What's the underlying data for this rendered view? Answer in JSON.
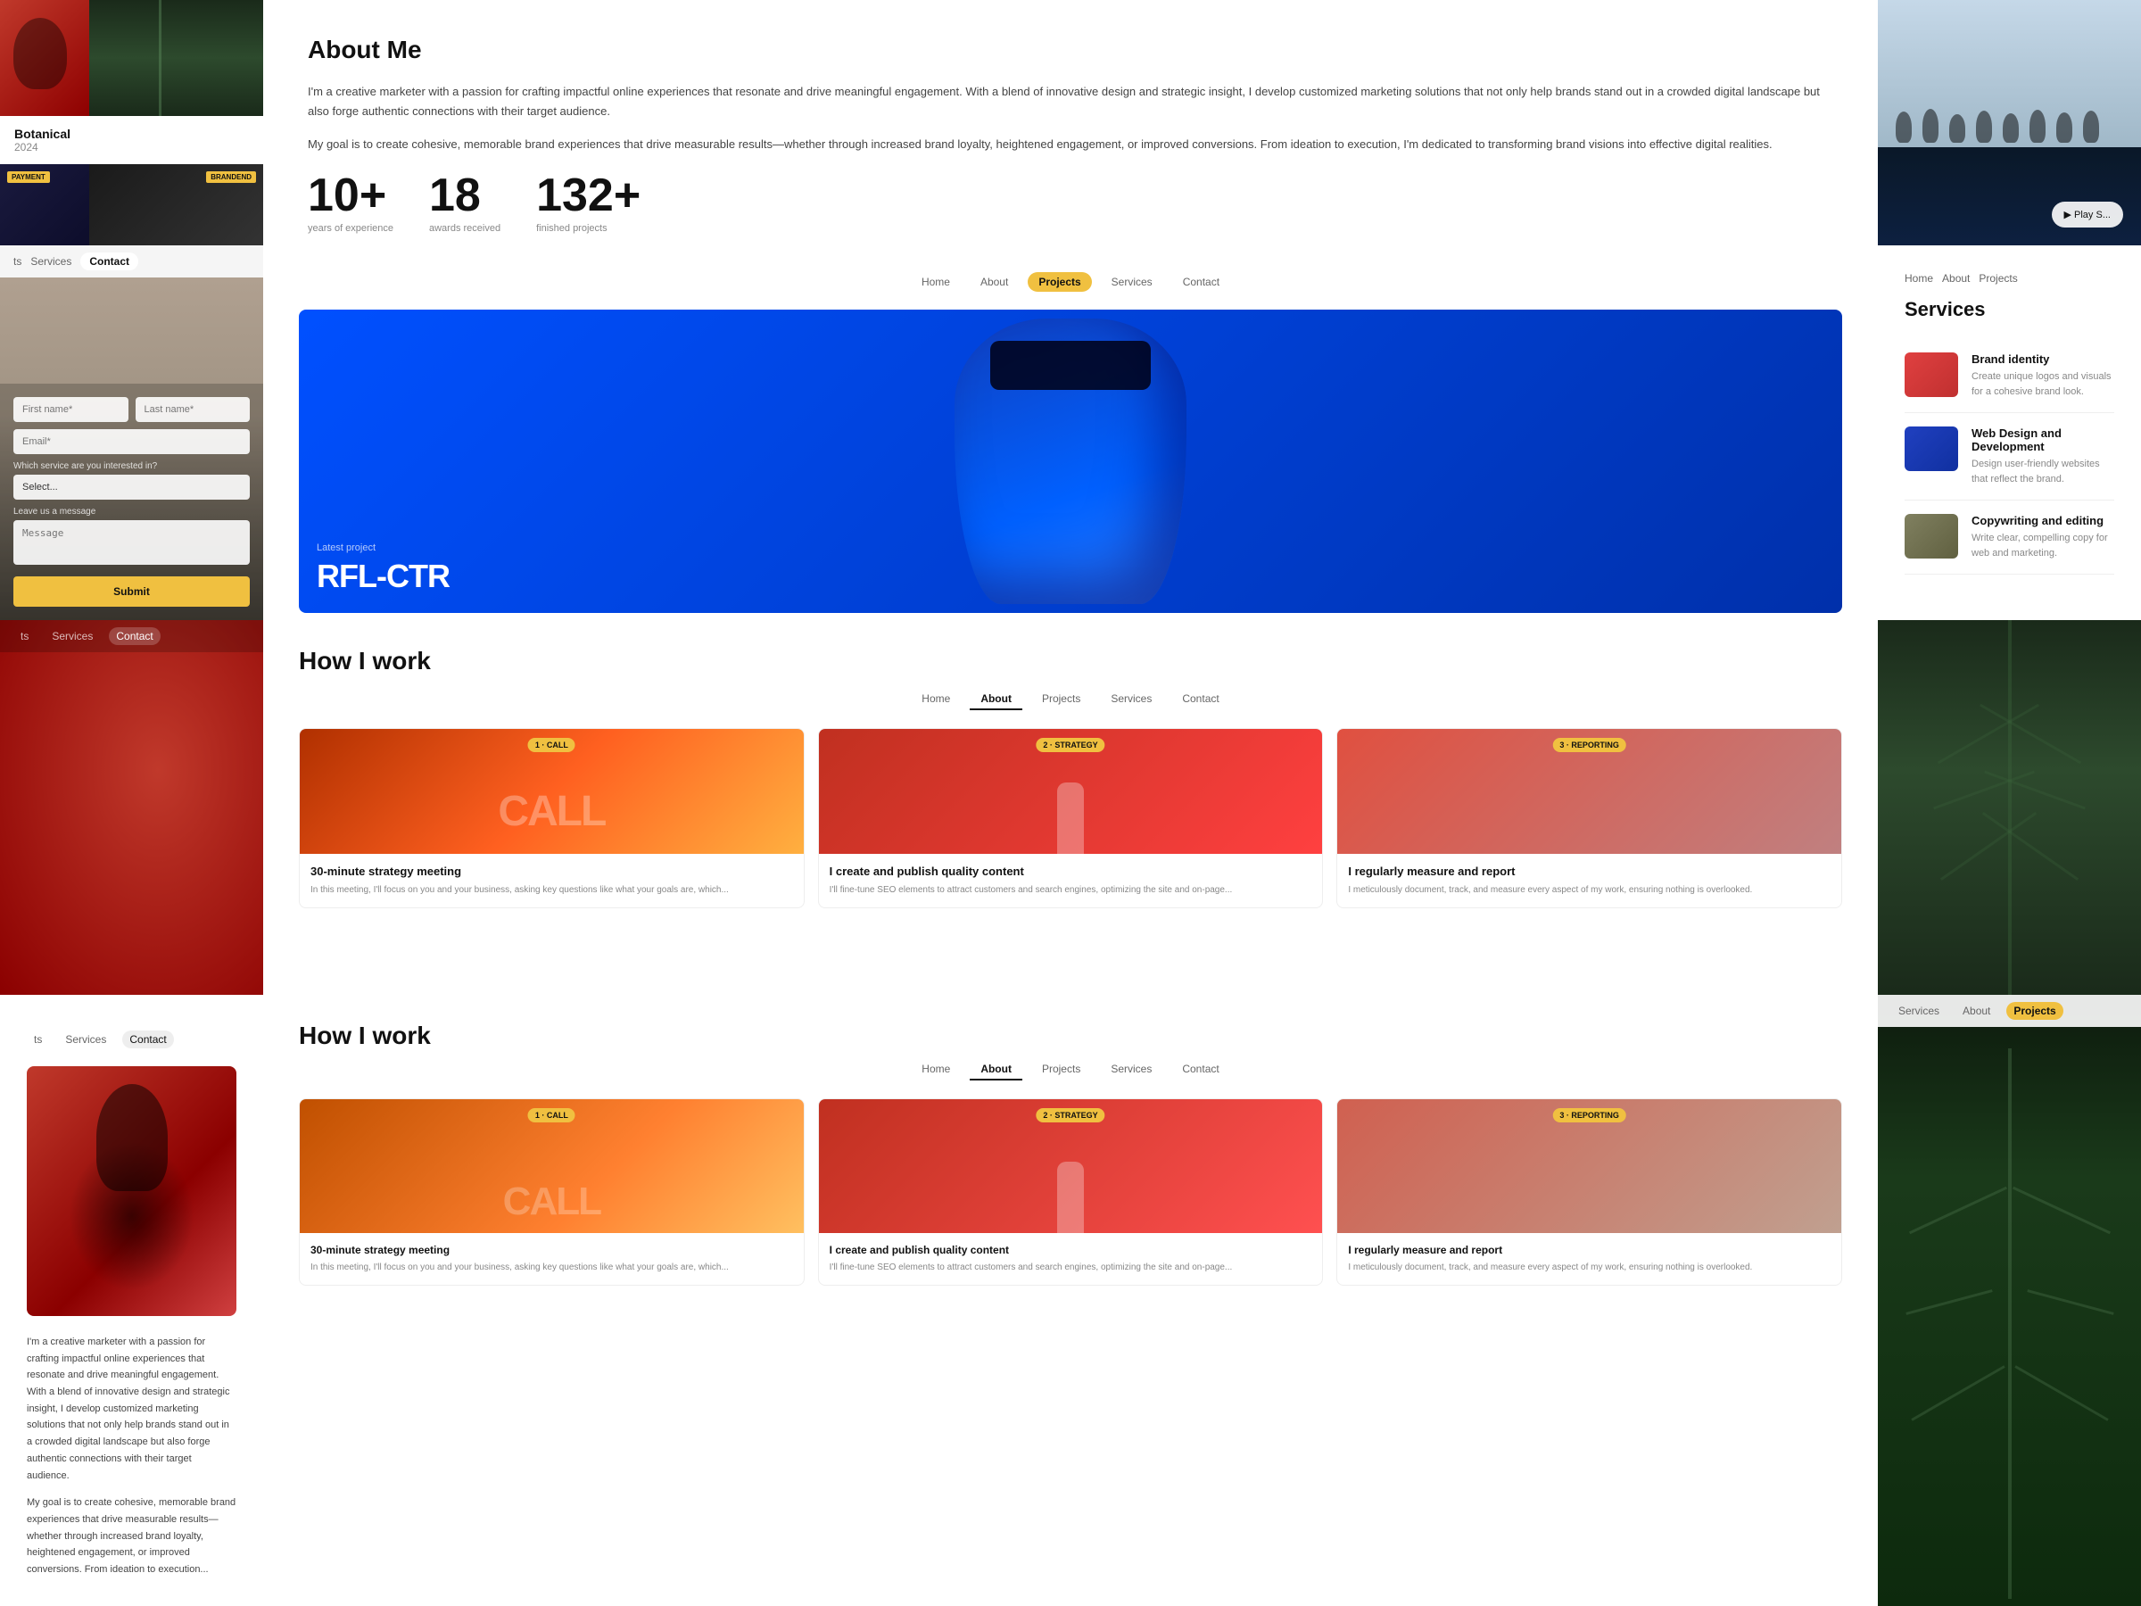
{
  "topLeft": {
    "botanical": {
      "title": "Botanical",
      "year": "2024"
    },
    "paymentBadge": "PAYMENT",
    "brandBadge": "BRANDEND"
  },
  "aboutMe": {
    "title": "About Me",
    "para1": "I'm a creative marketer with a passion for crafting impactful online experiences that resonate and drive meaningful engagement. With a blend of innovative design and strategic insight, I develop customized marketing solutions that not only help brands stand out in a crowded digital landscape but also forge authentic connections with their target audience.",
    "para2": "My goal is to create cohesive, memorable brand experiences that drive measurable results—whether through increased brand loyalty, heightened engagement, or improved conversions. From ideation to execution, I'm dedicated to transforming brand visions into effective digital realities.",
    "stats": [
      {
        "number": "10+",
        "label": "years of experience"
      },
      {
        "number": "18",
        "label": "awards received"
      },
      {
        "number": "132+",
        "label": "finished projects"
      }
    ]
  },
  "topRight": {
    "playLabel": "▶ Play S..."
  },
  "contactNav": {
    "items": [
      "ts",
      "Services",
      "Contact"
    ],
    "active": "Contact"
  },
  "form": {
    "firstName": "First name*",
    "lastName": "Last name*",
    "email": "Email*",
    "serviceLabel": "Which service are you interested in?",
    "selectPlaceholder": "Select...",
    "messageLabel": "Leave us a message",
    "messagePlaceholder": "Message",
    "submitLabel": "Submit"
  },
  "projectsNav": {
    "items": [
      "Home",
      "About",
      "Projects",
      "Services",
      "Contact"
    ],
    "active": "Projects"
  },
  "project": {
    "latestLabel": "Latest project",
    "name": "RFL-CTR"
  },
  "services": {
    "title": "Services",
    "nav": {
      "items": [
        "Home",
        "About",
        "Projects"
      ],
      "active": null
    },
    "items": [
      {
        "name": "Brand identity",
        "desc": "Create unique logos and visuals for a cohesive brand look."
      },
      {
        "name": "Web Design and Development",
        "desc": "Design user-friendly websites that reflect the brand."
      },
      {
        "name": "Copywriting and editing",
        "desc": "Write clear, compelling copy for web and marketing."
      }
    ]
  },
  "howIWork": {
    "title": "How I work",
    "nav": {
      "items": [
        "Home",
        "About",
        "Projects",
        "Services",
        "Contact"
      ],
      "active": "About"
    },
    "cards": [
      {
        "badge": "1 · CALL",
        "bigText": "CALL",
        "title": "30-minute strategy meeting",
        "text": "In this meeting, I'll focus on you and your business, asking key questions like what your goals are, which..."
      },
      {
        "badge": "2 · STRATEGY",
        "bigText": "",
        "title": "I create and publish quality content",
        "text": "I'll fine-tune SEO elements to attract customers and search engines, optimizing the site and on-page..."
      },
      {
        "badge": "3 · REPORTING",
        "bigText": "",
        "title": "I regularly measure and report",
        "text": "I meticulously document, track, and measure every aspect of my work, ensuring nothing is overlooked."
      }
    ]
  },
  "darkNav": {
    "items": [
      "ts",
      "Services",
      "Contact"
    ],
    "active": "Contact"
  },
  "botLeft": {
    "nav": {
      "items": [
        "ts",
        "Services",
        "Contact"
      ],
      "active": "Contact"
    },
    "text1": "I'm a creative marketer with a passion for crafting impactful online experiences that resonate and drive meaningful engagement. With a blend of innovative design and strategic insight, I develop customized marketing solutions that not only help brands stand out in a crowded digital landscape but also forge authentic connections with their target audience.",
    "text2": "My goal is to create cohesive, memorable brand experiences that drive measurable results—whether through increased brand loyalty, heightened engagement, or improved conversions. From ideation to execution..."
  },
  "botMid": {
    "title": "How I work",
    "nav": {
      "items": [
        "Home",
        "About",
        "Projects",
        "Services",
        "Contact"
      ],
      "active": "About"
    },
    "cards": [
      {
        "badge": "1 · CALL",
        "bigText": "CALL",
        "title": "30-minute strategy meeting",
        "text": "In this meeting, I'll focus on you and your business, asking key questions like what your goals are, which..."
      },
      {
        "badge": "2 · STRATEGY",
        "bigText": "",
        "title": "I create and publish quality content",
        "text": "I'll fine-tune SEO elements to attract customers and search engines, optimizing the site and on-page..."
      },
      {
        "badge": "3 · REPORTING",
        "bigText": "",
        "title": "I regularly measure and report",
        "text": "I meticulously document, track, and measure every aspect of my work, ensuring nothing is overlooked."
      }
    ]
  },
  "botRightNav": {
    "items": [
      "Services",
      "About",
      "Projects"
    ],
    "active": "Projects"
  }
}
